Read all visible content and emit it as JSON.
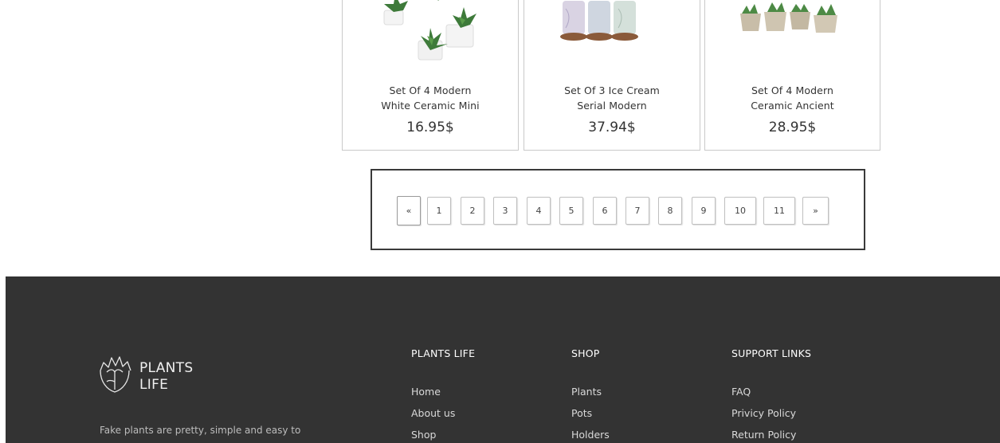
{
  "products": [
    {
      "name_line1": "Set Of 4 Modern",
      "name_line2": "White Ceramic Mini",
      "price": "16.95$"
    },
    {
      "name_line1": "Set Of 3 Ice Cream",
      "name_line2": "Serial Modern",
      "price": "37.94$"
    },
    {
      "name_line1": "Set Of 4 Modern",
      "name_line2": "Ceramic Ancient",
      "price": "28.95$"
    }
  ],
  "pagination": {
    "prev": "«",
    "pages": [
      "1",
      "2",
      "3",
      "4",
      "5",
      "6",
      "7",
      "8",
      "9",
      "10",
      "11"
    ],
    "next": "»"
  },
  "footer": {
    "brand_line1": "PLANTS",
    "brand_line2": "LIFE",
    "about_text": "Fake plants are pretty, simple and easy to",
    "columns": [
      {
        "title": "PLANTS LIFE",
        "links": [
          "Home",
          "About us",
          "Shop"
        ]
      },
      {
        "title": "SHOP",
        "links": [
          "Plants",
          "Pots",
          "Holders"
        ]
      },
      {
        "title": "SUPPORT LINKS",
        "links": [
          "FAQ",
          "Privicy Policy",
          "Return Policy"
        ]
      }
    ],
    "background": "#333333"
  }
}
